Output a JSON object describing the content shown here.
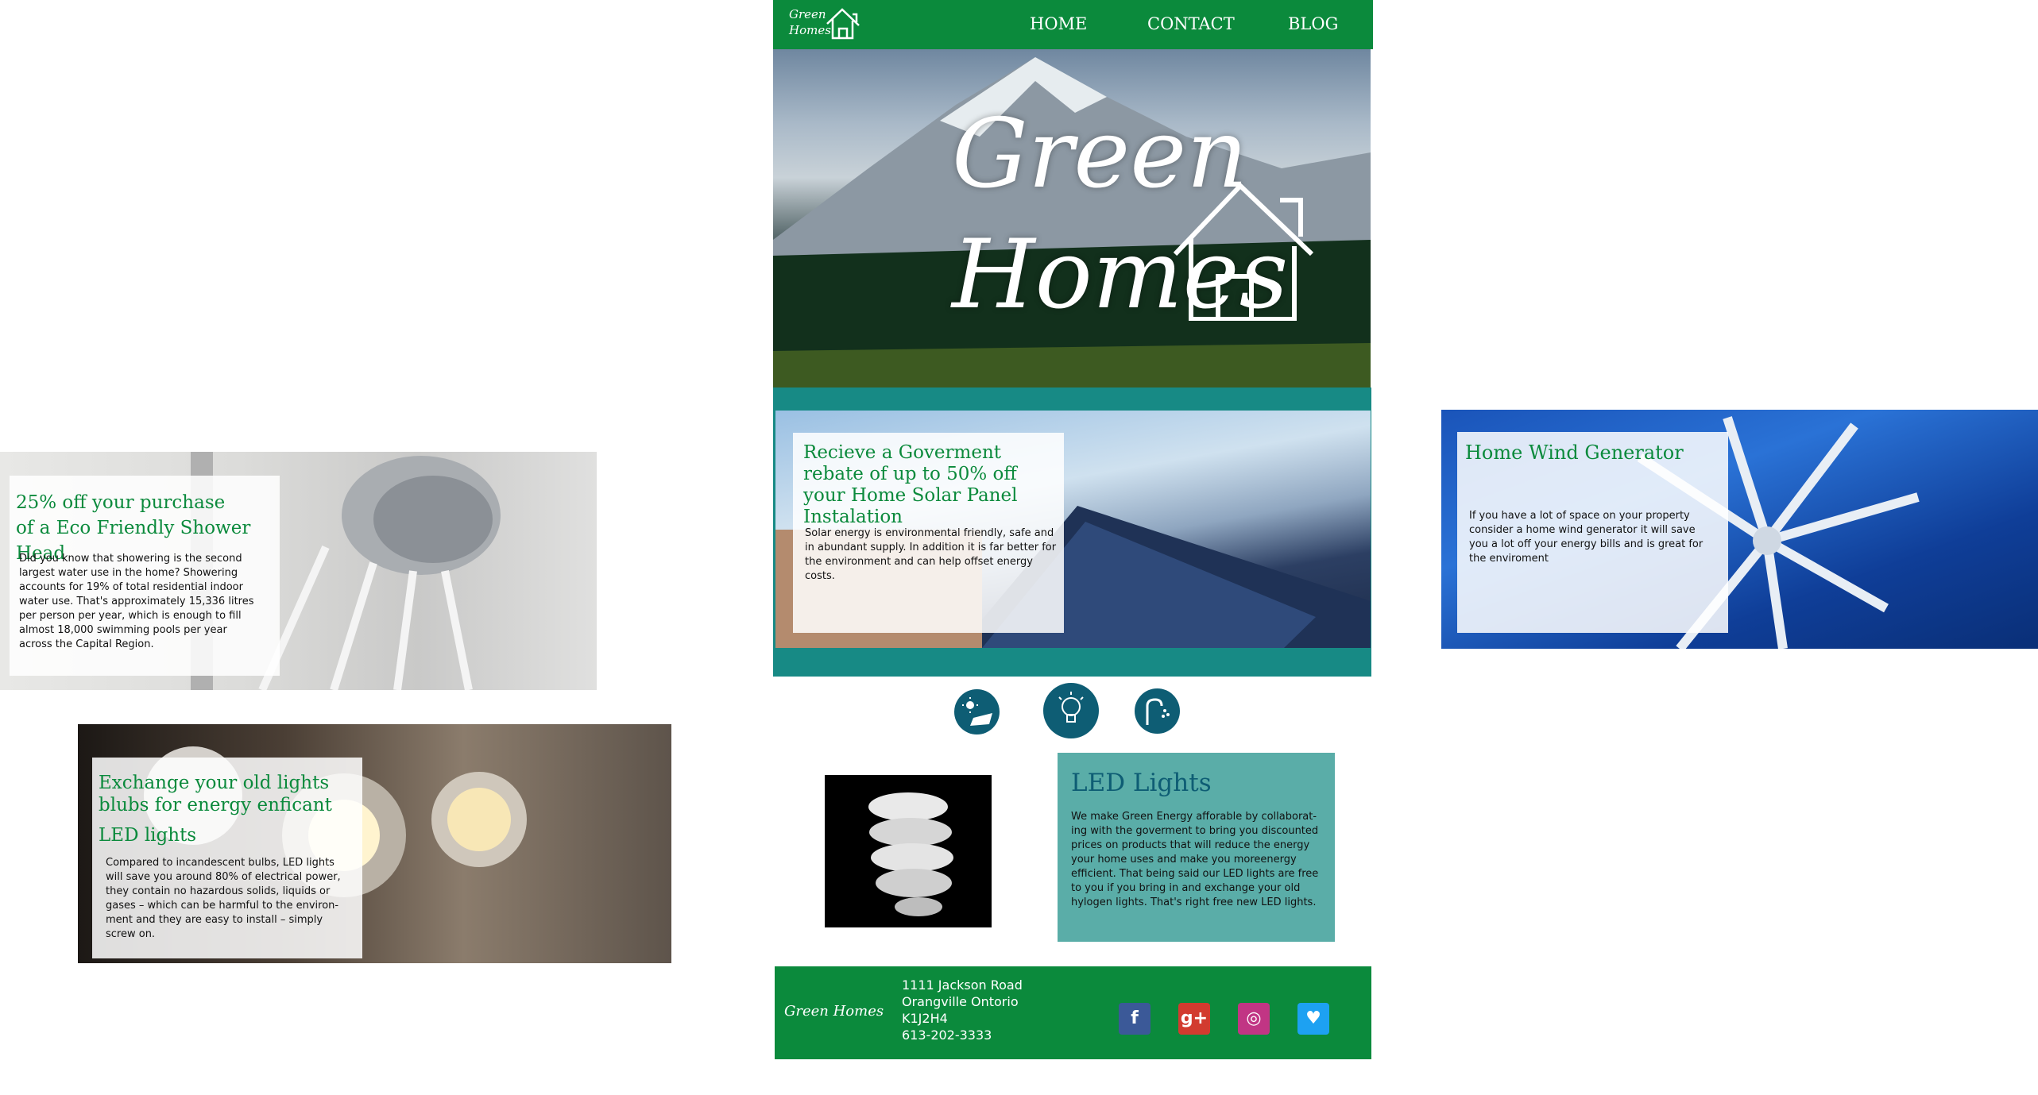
{
  "header": {
    "logo_line1": "Green",
    "logo_line2": "Homes",
    "nav": [
      "HOME",
      "CONTACT",
      "BLOG"
    ]
  },
  "hero": {
    "title_line1": "Green",
    "title_line2": "Homes"
  },
  "solar_card": {
    "title": "Recieve a Goverment rebate of up to 50% off your Home Solar Panel Instalation",
    "body": "Solar energy is environmental friendly, safe and in abundant supply. In addition it is far better for the environment and can help offset energy costs."
  },
  "icons": [
    "solar-panel-icon",
    "light-bulb-icon",
    "shower-head-icon"
  ],
  "led_feature": {
    "title": "LED Lights",
    "body": "We make Green Energy afforable by collaborat-ing with the goverment to bring you discounted prices on products that will reduce the energy your home uses and make you  moreenergy efficient. That being said our LED lights are free to you if you bring in and exchange your old hylogen lights. That's right free new LED lights."
  },
  "shower_card": {
    "title_line1": "25% off your purchase",
    "title_line2": "of a Eco Friendly Shower Head",
    "body": "Did you know that showering is the second largest water use in the home? Showering accounts for 19% of total residential indoor water use. That's approximately 15,336 litres per person per year, which is enough to fill almost 18,000 swimming pools per year across the Capital Region."
  },
  "wind_card": {
    "title": "Home Wind Generator",
    "body": "If you have a lot of space on your property consider a home wind generator it will save you a lot off your energy bills and is great for the enviroment"
  },
  "led_card": {
    "title_line1": "Exchange your old lights",
    "title_line2": "blubs for energy enficant",
    "title_line3": "LED lights",
    "body": "Compared to incandescent bulbs, LED lights will save you around 80% of electrical power, they contain no hazardous solids, liquids or gases – which can be harmful to the environ-ment and they are easy to install – simply screw on."
  },
  "footer": {
    "logo": "Green Homes",
    "address_line1": "1111 Jackson Road",
    "address_line2": "Orangville Ontorio",
    "address_line3": "K1J2H4",
    "phone": "613-202-3333",
    "social": [
      {
        "name": "facebook-icon",
        "glyph": "f",
        "color": "#3b5998"
      },
      {
        "name": "google-plus-icon",
        "glyph": "g+",
        "color": "#d23b2f"
      },
      {
        "name": "instagram-icon",
        "glyph": "◎",
        "color": "#c13584"
      },
      {
        "name": "twitter-icon",
        "glyph": "♥",
        "color": "#1da1f2"
      }
    ]
  }
}
